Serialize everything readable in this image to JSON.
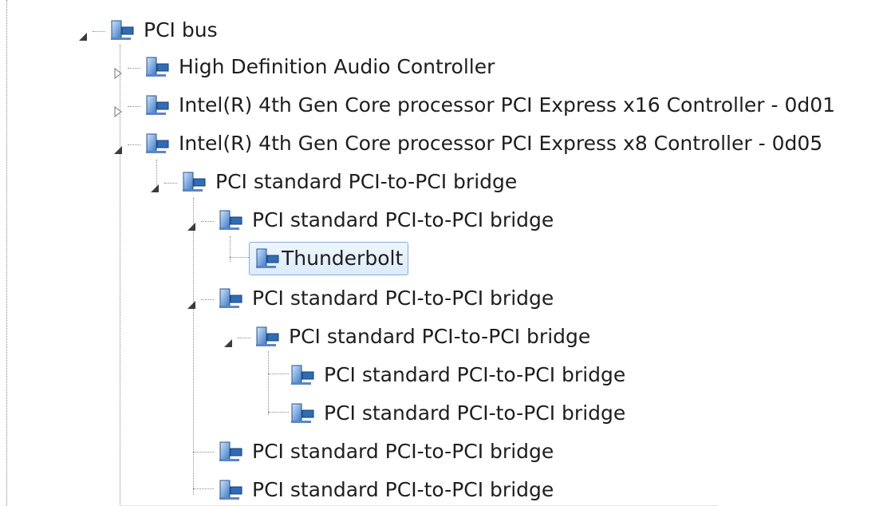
{
  "tree": {
    "nodes": [
      {
        "label": "PCI bus",
        "expander": "expanded",
        "icon": "network-adapter-icon",
        "selected": false
      },
      {
        "label": "High Definition Audio Controller",
        "expander": "collapsed",
        "icon": "network-adapter-icon",
        "selected": false
      },
      {
        "label": "Intel(R) 4th Gen Core processor PCI Express x16 Controller - 0d01",
        "expander": "collapsed",
        "icon": "network-adapter-icon",
        "selected": false
      },
      {
        "label": "Intel(R) 4th Gen Core processor PCI Express x8 Controller - 0d05",
        "expander": "expanded",
        "icon": "network-adapter-icon",
        "selected": false
      },
      {
        "label": "PCI standard PCI-to-PCI bridge",
        "expander": "expanded",
        "icon": "network-adapter-icon",
        "selected": false
      },
      {
        "label": "PCI standard PCI-to-PCI bridge",
        "expander": "expanded",
        "icon": "network-adapter-icon",
        "selected": false
      },
      {
        "label": "Thunderbolt",
        "expander": "none",
        "icon": "network-adapter-icon",
        "selected": true
      },
      {
        "label": "PCI standard PCI-to-PCI bridge",
        "expander": "expanded",
        "icon": "network-adapter-icon",
        "selected": false
      },
      {
        "label": "PCI standard PCI-to-PCI bridge",
        "expander": "expanded",
        "icon": "network-adapter-icon",
        "selected": false
      },
      {
        "label": "PCI standard PCI-to-PCI bridge",
        "expander": "none",
        "icon": "network-adapter-icon",
        "selected": false
      },
      {
        "label": "PCI standard PCI-to-PCI bridge",
        "expander": "none",
        "icon": "network-adapter-icon",
        "selected": false
      },
      {
        "label": "PCI standard PCI-to-PCI bridge",
        "expander": "none",
        "icon": "network-adapter-icon",
        "selected": false
      },
      {
        "label": "PCI standard PCI-to-PCI bridge",
        "expander": "none",
        "icon": "network-adapter-icon",
        "selected": false
      }
    ]
  },
  "colors": {
    "selection_border": "#84acdd",
    "selection_fill": "#dcebfb",
    "tree_lines": "#8a8a8a"
  }
}
